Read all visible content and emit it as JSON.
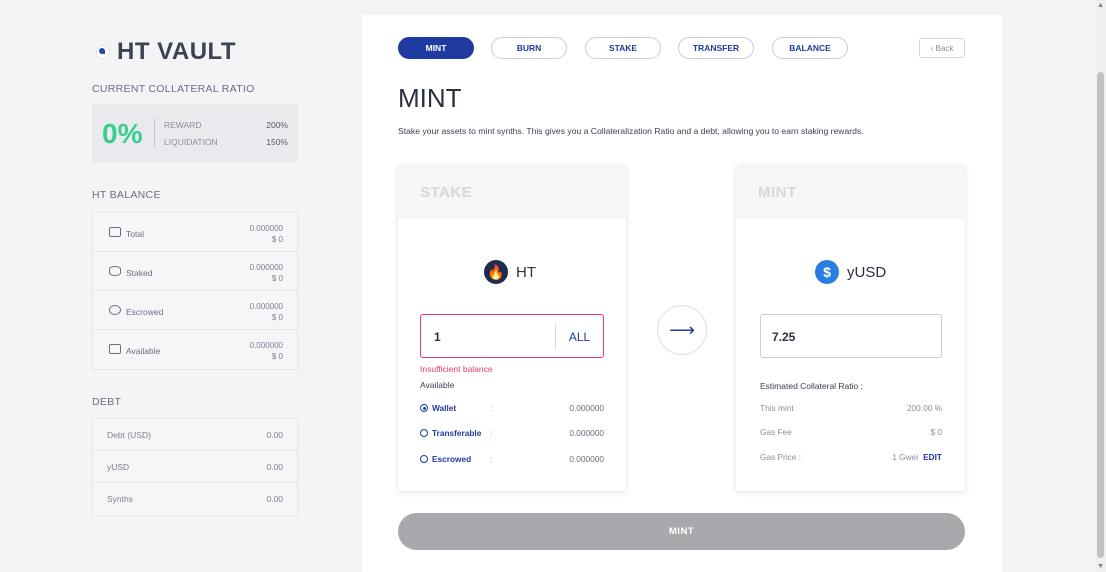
{
  "sidebar": {
    "logo": "HT VAULT",
    "ratio_label": "CURRENT COLLATERAL RATIO",
    "ratio_value": "0%",
    "reward_label": "REWARD",
    "reward_value": "200%",
    "liquidation_label": "LIQUIDATION",
    "liquidation_value": "150%",
    "balance_label": "HT BALANCE",
    "balances": [
      {
        "icon": "wallet-icon",
        "name": "Total",
        "amount": "0.000000",
        "usd": "$ 0"
      },
      {
        "icon": "database-icon",
        "name": "Staked",
        "amount": "0.000000",
        "usd": "$ 0"
      },
      {
        "icon": "coins-icon",
        "name": "Escrowed",
        "amount": "0.000000",
        "usd": "$ 0"
      },
      {
        "icon": "folder-icon",
        "name": "Available",
        "amount": "0.000000",
        "usd": "$ 0"
      }
    ],
    "debt_label": "DEBT",
    "debts": [
      {
        "name": "Debt (USD)",
        "value": "0.00"
      },
      {
        "name": "yUSD",
        "value": "0.00"
      },
      {
        "name": "Synths",
        "value": "0.00"
      }
    ]
  },
  "tabs": [
    {
      "label": "MINT",
      "active": true
    },
    {
      "label": "BURN",
      "active": false
    },
    {
      "label": "STAKE",
      "active": false
    },
    {
      "label": "TRANSFER",
      "active": false
    },
    {
      "label": "BALANCE",
      "active": false
    }
  ],
  "back_label": "‹ Back",
  "page_title": "MINT",
  "page_desc": "Stake your assets to mint synths. This gives you a Collateralization Ratio and a debt, allowing you to earn staking rewards.",
  "stake_card": {
    "title": "STAKE",
    "token": "HT",
    "input_value": "1",
    "all_label": "ALL",
    "error": "Insufficient balance",
    "available_label": "Available",
    "options": [
      {
        "name": "Wallet",
        "value": "0.000000",
        "selected": true
      },
      {
        "name": "Transferable",
        "value": "0.000000",
        "selected": false
      },
      {
        "name": "Escrowed",
        "value": "0.000000",
        "selected": false
      }
    ]
  },
  "arrow": "⟶",
  "mint_card": {
    "title": "MINT",
    "token": "yUSD",
    "token_symbol": "$",
    "output_value": "7.25",
    "ratio_label": "Estimated Collateral Ratio :",
    "this_mint_label": "This mint",
    "this_mint_value": "200.00 %",
    "gas_fee_label": "Gas Fee",
    "gas_fee_value": "$ 0",
    "gas_price_label": "Gas Price :",
    "gas_price_value": "1 Gwei",
    "edit_label": "EDIT"
  },
  "mint_button": "MINT",
  "colors": {
    "accent": "#1f3aa0",
    "success": "#36cf8d",
    "error": "#e83a6b",
    "disabled": "#a9a9ad"
  }
}
